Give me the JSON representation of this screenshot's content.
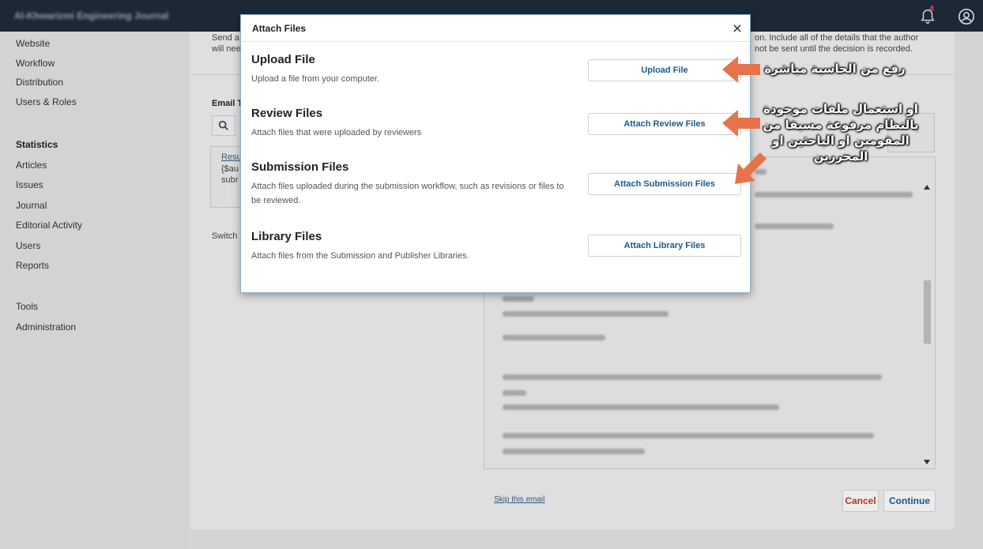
{
  "topbar": {
    "journal_name": "Al-Khwarizmi Engineering Journal",
    "notification_count": "4",
    "icons": [
      "bell-icon",
      "user-icon"
    ]
  },
  "sidebar": {
    "items": [
      {
        "label": "Website"
      },
      {
        "label": "Workflow"
      },
      {
        "label": "Distribution"
      },
      {
        "label": "Users & Roles"
      },
      {
        "label": "Statistics",
        "heading": true
      },
      {
        "label": "Articles"
      },
      {
        "label": "Issues"
      },
      {
        "label": "Journal"
      },
      {
        "label": "Editorial Activity"
      },
      {
        "label": "Users"
      },
      {
        "label": "Reports"
      },
      {
        "label": "Tools"
      },
      {
        "label": "Administration"
      }
    ]
  },
  "background": {
    "intro_fragment_left_1": "Send a",
    "intro_fragment_left_2": "will nee",
    "intro_fragment_right_1": "on. Include all of the details that the author",
    "intro_fragment_right_2": "not be sent until the decision is recorded.",
    "email_label": "Email T",
    "result_link": "Resu",
    "result_line_1": "{$au",
    "result_line_2": "subr",
    "switch_label": "Switch",
    "skip_link": "Skip this email",
    "cancel_label": "Cancel",
    "continue_label": "Continue"
  },
  "modal": {
    "title": "Attach Files",
    "close_label": "×",
    "sections": [
      {
        "title": "Upload File",
        "description": "Upload a file from your computer.",
        "button": "Upload File"
      },
      {
        "title": "Review Files",
        "description": "Attach files that were uploaded by reviewers",
        "button": "Attach Review Files"
      },
      {
        "title": "Submission Files",
        "description": "Attach files uploaded during the submission workflow, such as revisions or files to be reviewed.",
        "button": "Attach Submission Files"
      },
      {
        "title": "Library Files",
        "description": "Attach files from the Submission and Publisher Libraries.",
        "button": "Attach Library Files"
      }
    ]
  },
  "annotations": {
    "upload": "رفع من الحاسبة مباشرة",
    "existing": "او استعمال ملفات موجودة بالنظام مرفوعة مسبقا من المقومين او الباحثين او المحررين",
    "arrow_color": "#e8734a"
  }
}
